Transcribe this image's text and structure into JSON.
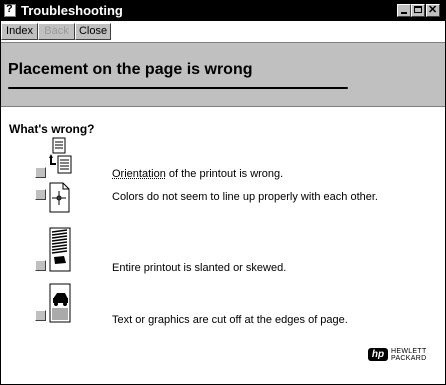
{
  "window": {
    "title": "Troubleshooting"
  },
  "toolbar": {
    "index_label": "Index",
    "back_label": "Back",
    "close_label": "Close"
  },
  "page": {
    "title": "Placement on the page is wrong",
    "section_heading": "What's wrong?"
  },
  "items": [
    {
      "link": "Orientation",
      "text": " of the printout is wrong."
    },
    {
      "text": "Colors do not seem to line up properly with each other."
    },
    {
      "text": "Entire printout is slanted or skewed."
    },
    {
      "text": "Text or graphics are cut off at the edges of page."
    }
  ],
  "logo": {
    "mark": "hp",
    "line1": "HEWLETT",
    "line2": "PACKARD"
  },
  "colors": {
    "titlebar": "#000000",
    "header": "#c0c0c0",
    "button": "#c0c0c0"
  }
}
